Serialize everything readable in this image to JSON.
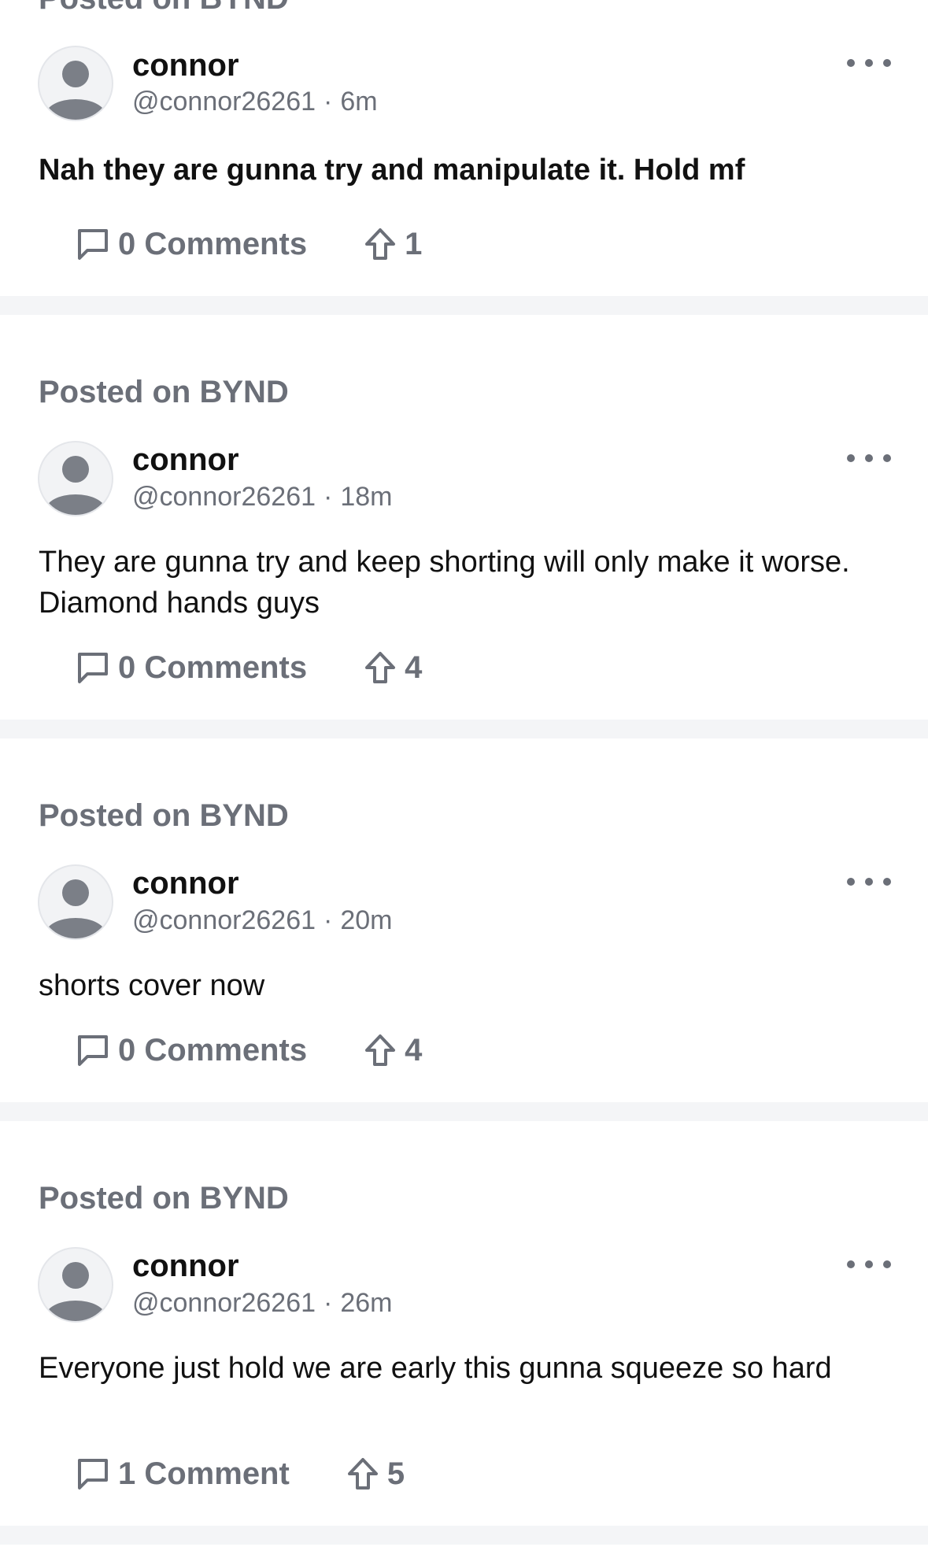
{
  "posts": [
    {
      "posted_on": "Posted on BYND",
      "author": "connor",
      "handle": "@connor26261",
      "separator": "·",
      "time": "6m",
      "text": "Nah they are gunna try and manipulate it. Hold mf",
      "comments": "0 Comments",
      "upvotes": "1"
    },
    {
      "posted_on": "Posted on BYND",
      "author": "connor",
      "handle": "@connor26261",
      "separator": "·",
      "time": "18m",
      "text": "They are gunna try and keep shorting will only make it worse. Diamond hands guys",
      "comments": "0 Comments",
      "upvotes": "4"
    },
    {
      "posted_on": "Posted on BYND",
      "author": "connor",
      "handle": "@connor26261",
      "separator": "·",
      "time": "20m",
      "text": "shorts cover now",
      "comments": "0 Comments",
      "upvotes": "4"
    },
    {
      "posted_on": "Posted on BYND",
      "author": "connor",
      "handle": "@connor26261",
      "separator": "·",
      "time": "26m",
      "text": "Everyone just hold we are early this gunna squeeze so hard",
      "comments": "1 Comment",
      "upvotes": "5"
    }
  ],
  "icons": {
    "comment": "comment-icon",
    "upvote": "upvote-arrow-icon",
    "more": "more-options-icon",
    "avatar": "default-avatar-icon"
  },
  "colors": {
    "text": "#111111",
    "muted": "#6b6f78",
    "separator": "#f4f5f7",
    "avatar_bg": "#f2f3f5"
  }
}
